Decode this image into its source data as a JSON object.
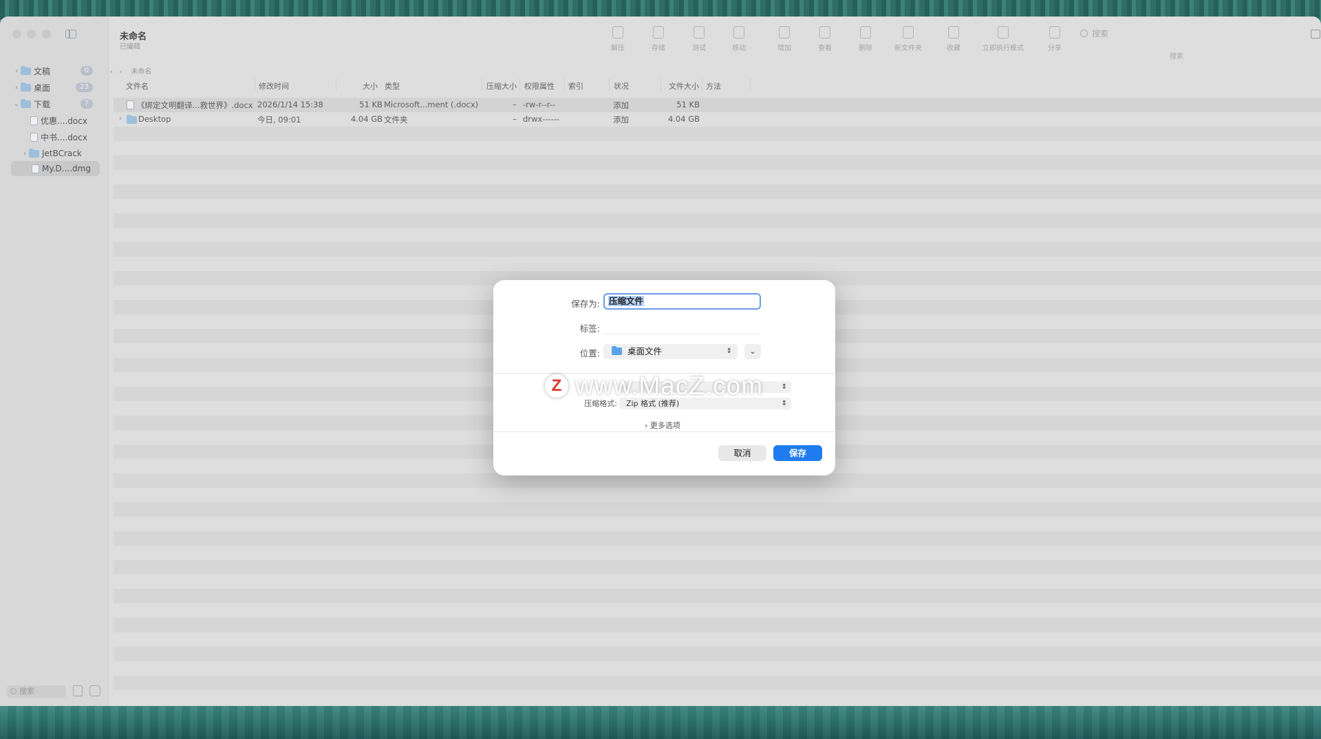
{
  "window": {
    "title": "未命名",
    "subtitle": "已编辑"
  },
  "sidebar": {
    "items": [
      {
        "label": "文稿",
        "badge": "0"
      },
      {
        "label": "桌面",
        "badge": "23"
      },
      {
        "label": "下载",
        "badge": "7"
      },
      {
        "label": "优惠....docx"
      },
      {
        "label": "中书....docx"
      },
      {
        "label": "JetBCrack"
      },
      {
        "label": "My.D....dmg"
      }
    ],
    "search_placeholder": "搜索"
  },
  "toolbar": {
    "items": [
      "解压",
      "存储",
      "测试",
      "移动",
      "增加",
      "查看",
      "删除",
      "新文件夹",
      "收藏",
      "立即执行模式",
      "分享"
    ],
    "search_placeholder": "搜索",
    "search_label": "搜索"
  },
  "breadcrumb": "未命名",
  "columns": [
    "文件名",
    "修改时间",
    "大小",
    "类型",
    "压缩大小",
    "权限属性",
    "索引",
    "状况",
    "文件大小",
    "方法"
  ],
  "rows": [
    {
      "name": "《绑定文明翻译...救世界》.docx",
      "modified": "2026/1/14 15:38",
      "size": "51 KB",
      "type": "Microsoft...ment (.docx)",
      "packed": "–",
      "perms": "-rw-r--r--",
      "index": "",
      "status": "添加",
      "filesize": "51 KB"
    },
    {
      "name": "Desktop",
      "modified": "今日, 09:01",
      "size": "4.04 GB",
      "type": "文件夹",
      "packed": "–",
      "perms": "drwx------",
      "index": "",
      "status": "添加",
      "filesize": "4.04 GB"
    }
  ],
  "dialog": {
    "save_as_label": "保存为:",
    "save_as_value": "压缩文件",
    "tags_label": "标签:",
    "location_label": "位置:",
    "location_value": "桌面文件",
    "format_label": "压缩格式:",
    "format_value": "Zip 格式 (推荐)",
    "more_options": "更多选项",
    "cancel": "取消",
    "save": "保存"
  },
  "watermark": "www.MacZ.com",
  "colors": {
    "accent": "#1f7cf0",
    "selection": "#b4d3fa"
  }
}
